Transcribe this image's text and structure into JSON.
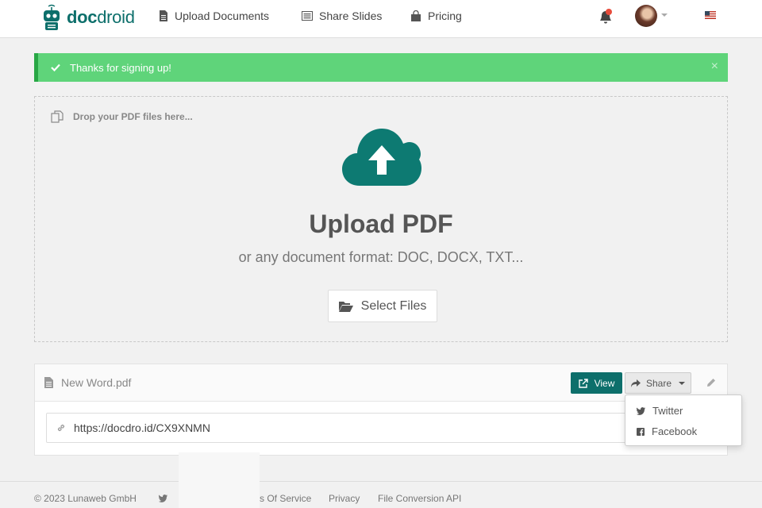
{
  "header": {
    "logo_text_1": "doc",
    "logo_text_2": "droid",
    "nav": [
      {
        "label": "Upload Documents",
        "icon": "file-icon"
      },
      {
        "label": "Share Slides",
        "icon": "slides-icon"
      },
      {
        "label": "Pricing",
        "icon": "shopping-bag-icon"
      }
    ],
    "notification_color": "#e74c3c"
  },
  "alert": {
    "message": "Thanks for signing up!",
    "close": "×",
    "color": "#5fd47a"
  },
  "dropzone": {
    "hint": "Drop your PDF files here...",
    "title": "Upload PDF",
    "subtitle": "or any document format: DOC, DOCX, TXT...",
    "button": "Select Files",
    "cloud_color": "#0d7a72"
  },
  "file": {
    "name": "New Word.pdf",
    "view": "View",
    "share": "Share",
    "url": "https://docdro.id/CX9XNMN"
  },
  "share_menu": [
    {
      "label": "Twitter",
      "icon": "twitter-icon"
    },
    {
      "label": "Facebook",
      "icon": "facebook-icon"
    }
  ],
  "footer": {
    "copyright": "© 2023 Lunaweb GmbH",
    "terms": "s Of Service",
    "privacy": "Privacy",
    "api": "File Conversion API"
  }
}
